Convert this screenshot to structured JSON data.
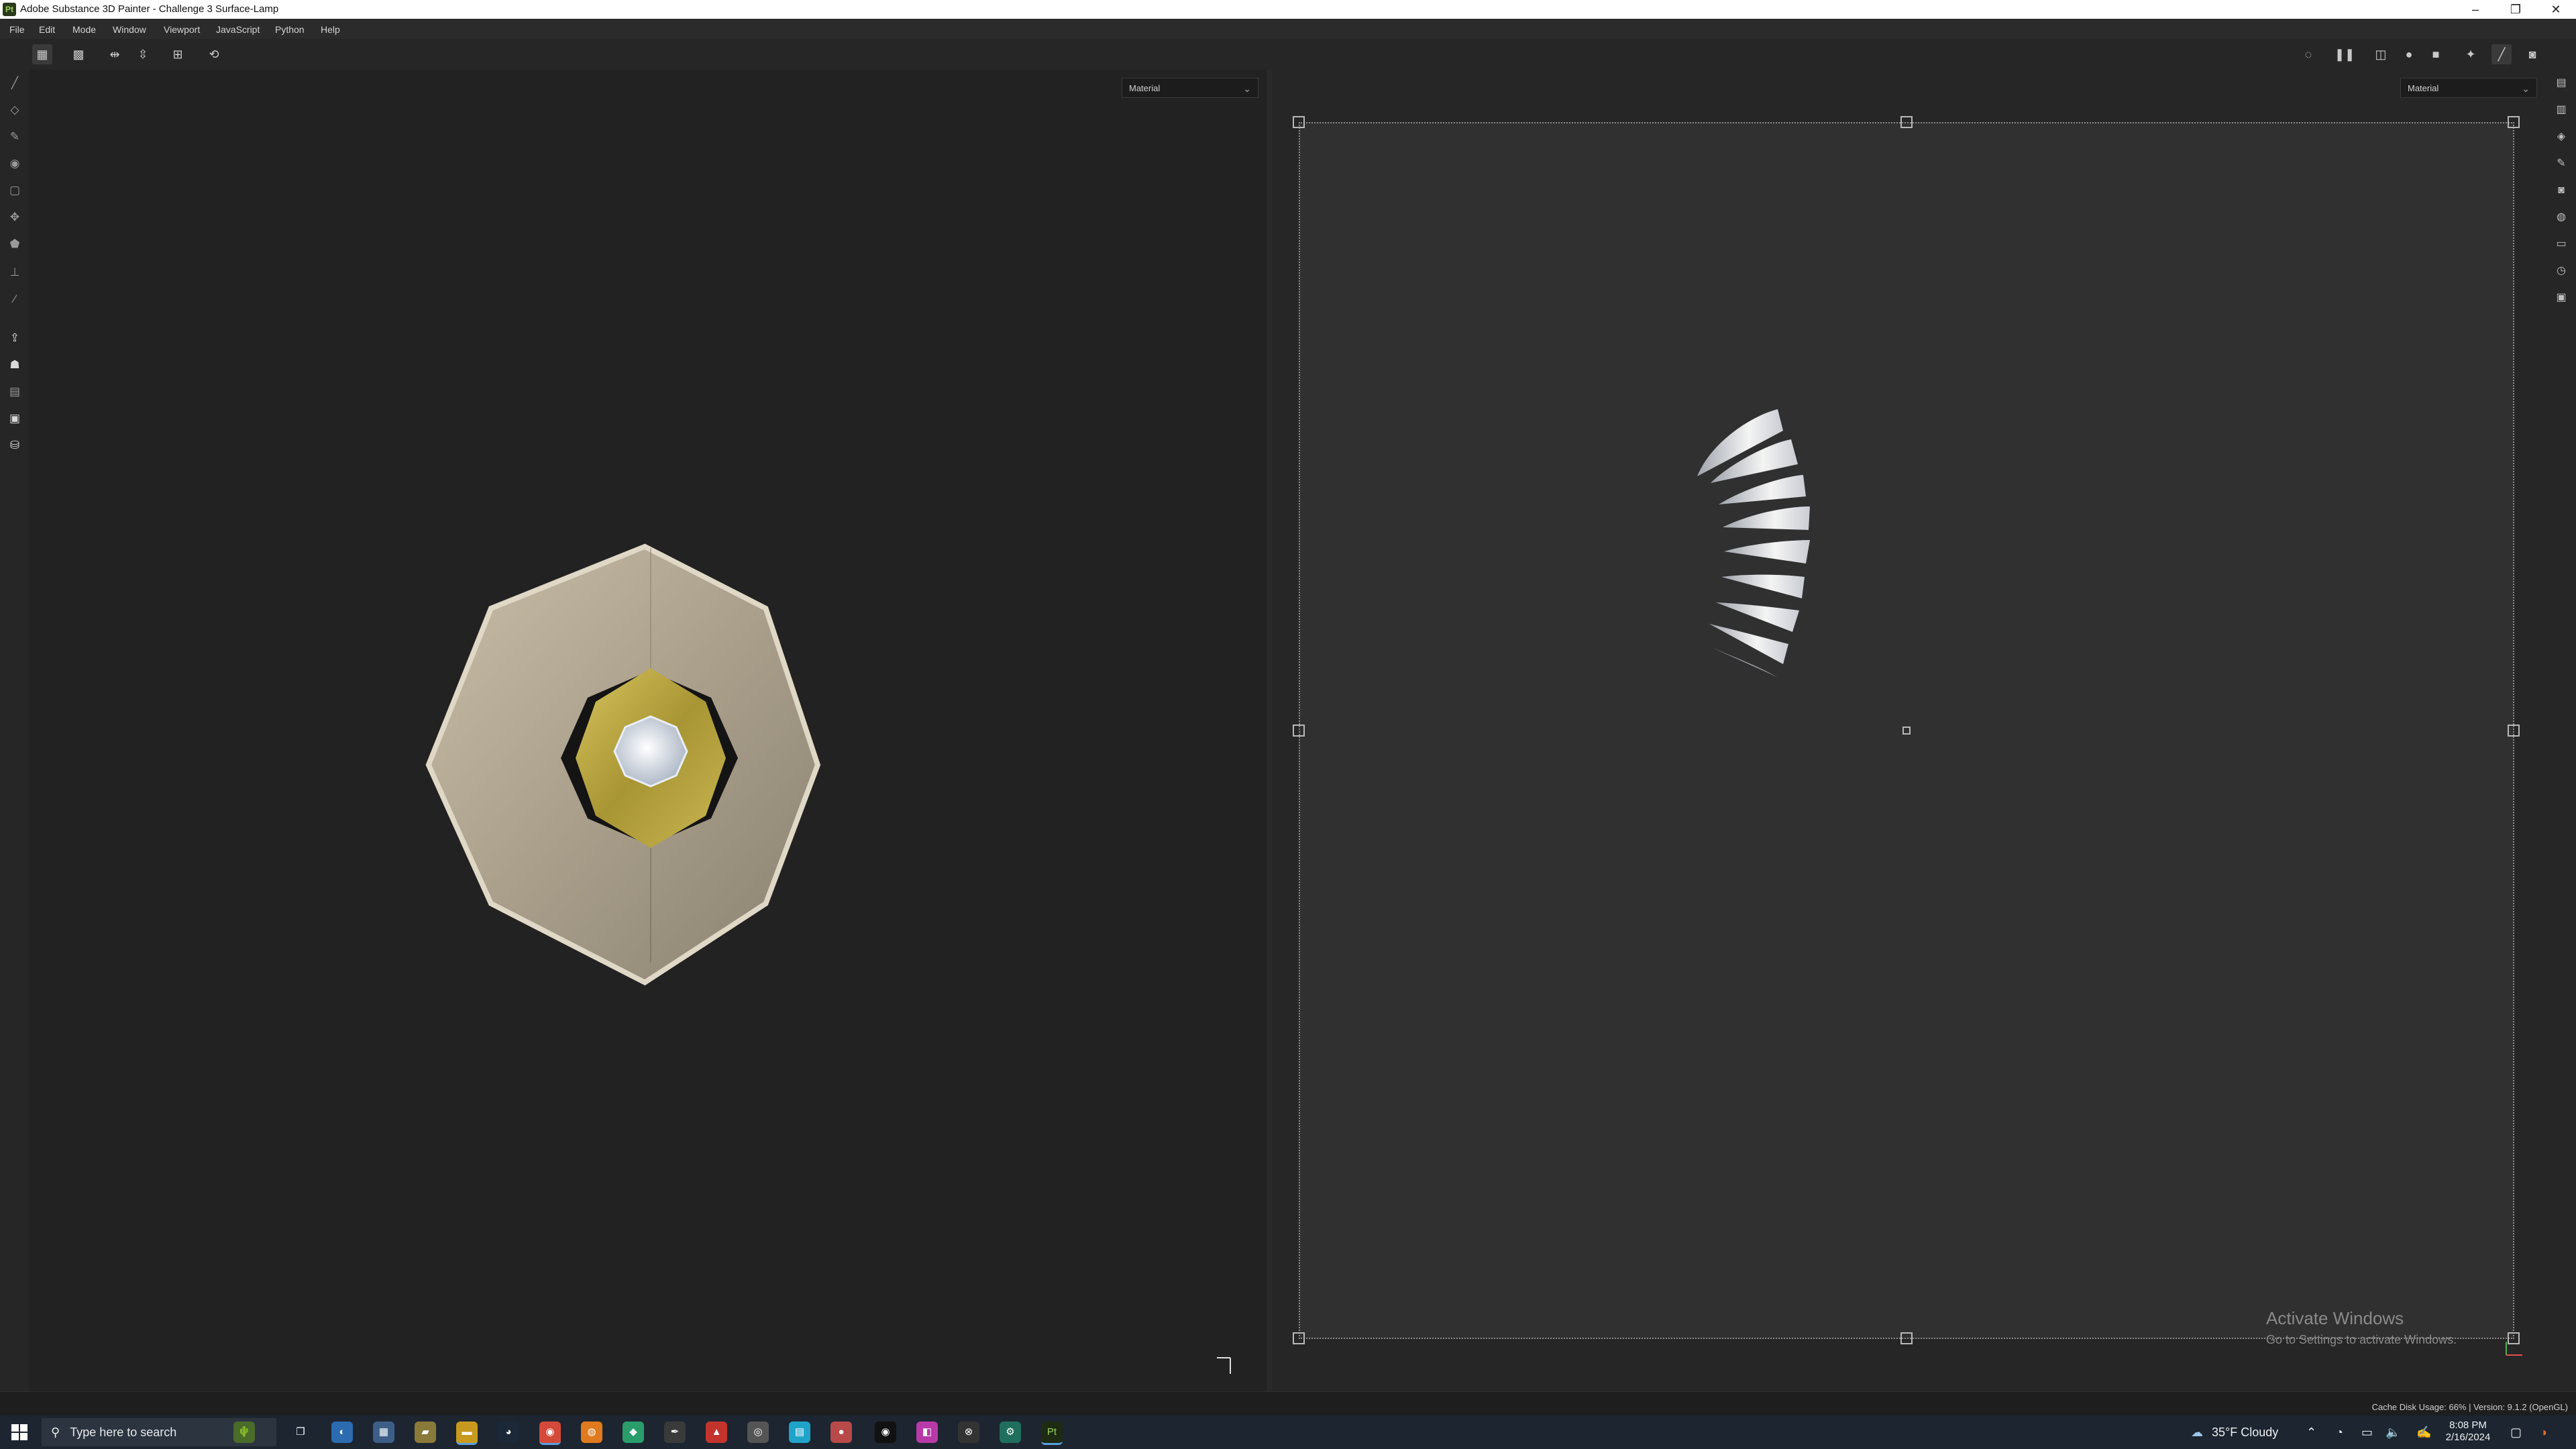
{
  "window": {
    "app_icon_text": "Pt",
    "title": "Adobe Substance 3D Painter - Challenge 3 Surface-Lamp",
    "controls": {
      "minimize": "–",
      "restore": "❐",
      "close": "✕"
    }
  },
  "menu": [
    "File",
    "Edit",
    "Mode",
    "Window",
    "Viewport",
    "JavaScript",
    "Python",
    "Help"
  ],
  "toolbar": {
    "left_icons": [
      "grid-view-icon",
      "grid-dense-icon",
      "mirror-x-icon",
      "mirror-y-icon",
      "add-frame-icon",
      "history-icon"
    ],
    "right_icons": [
      "hide-icon",
      "pause-icon",
      "uv-split-icon",
      "material-ball-icon",
      "camera-icon",
      "bake-icon",
      "brush-icon",
      "screenshot-icon"
    ]
  },
  "left_tools": [
    "paint-brush-icon",
    "eraser-icon",
    "projection-icon",
    "geometry-mask-icon",
    "smudge-icon",
    "clone-icon",
    "polygon-fill-icon",
    "stamp-icon",
    "color-picker-icon",
    "export-icon",
    "bake-mesh-icon",
    "texture-set-icon",
    "document-icon",
    "resource-icon"
  ],
  "right_panel_icons": [
    "layers-panel-icon",
    "texture-set-panel-icon",
    "stack-icon",
    "brush-settings-icon",
    "display-icon",
    "environment-icon",
    "shelf-icon",
    "history-panel-icon",
    "log-icon"
  ],
  "viewport_3d": {
    "channel_select": "Material"
  },
  "viewport_2d": {
    "channel_select": "Material"
  },
  "watermark": {
    "line1": "Activate Windows",
    "line2": "Go to Settings to activate Windows."
  },
  "status": {
    "text": "Cache Disk Usage:  66% | Version: 9.1.2 (OpenGL)"
  },
  "taskbar": {
    "search_placeholder": "Type here to search",
    "weather": "35°F  Cloudy",
    "time": "8:08 PM",
    "date": "2/16/2024",
    "apps": [
      "task-view",
      "copilot",
      "calculator",
      "file-explorer",
      "folder",
      "steam",
      "chrome",
      "blender",
      "webstorm",
      "inkscape",
      "acrobat",
      "search-app",
      "notes",
      "red-app",
      "obs",
      "figma",
      "xbox",
      "gear",
      "substance-painter"
    ]
  },
  "colors": {
    "accent": "#2b78d0",
    "brass": "#b8a446",
    "stone": "#b6aa94",
    "painter_green": "#9bd35b"
  }
}
